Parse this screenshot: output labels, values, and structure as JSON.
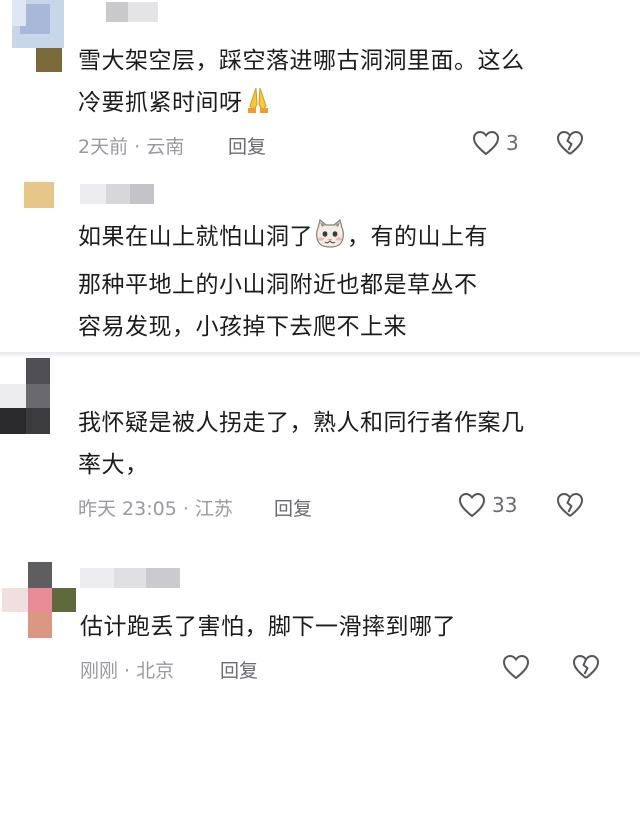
{
  "comments": [
    {
      "text_lines": [
        "雪大架空层，踩空落进哪古洞洞里面。这么",
        "冷要抓紧时间呀"
      ],
      "meta": "2天前 · 云南",
      "reply": "回复",
      "likes": "3",
      "emoji": "folded-hands"
    },
    {
      "text_lines": [
        "如果在山上就怕山洞了",
        "，有的山上有",
        "那种平地上的小山洞附近也都是草丛不",
        "容易发现，小孩掉下去爬不上来"
      ],
      "emoji": "cat-face"
    },
    {
      "text_lines": [
        "我怀疑是被人拐走了，熟人和同行者作案几",
        "率大，"
      ],
      "meta": "昨天 23:05 · 江苏",
      "reply": "回复",
      "likes": "33"
    },
    {
      "text_lines": [
        "估计跑丢了害怕，脚下一滑摔到哪了"
      ],
      "meta": "刚刚 · 北京",
      "reply": "回复"
    }
  ],
  "colors": {
    "text": "#1c1c1e",
    "meta": "#9a9aa0",
    "reply": "#6a6a70",
    "icon_stroke": "#55555a"
  },
  "icons": [
    "heart-outline-icon",
    "broken-heart-icon",
    "folded-hands-emoji",
    "cat-face-emoji"
  ]
}
